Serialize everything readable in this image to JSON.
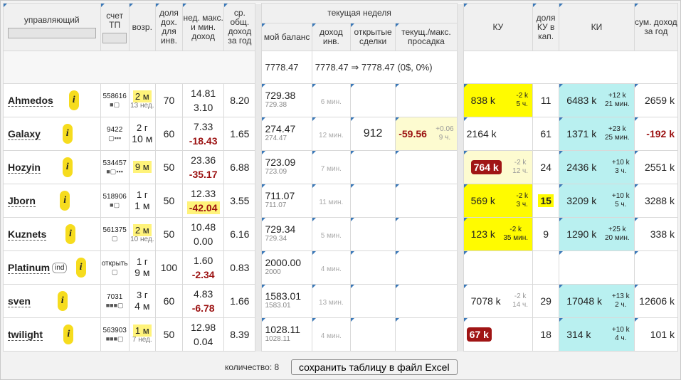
{
  "headers": {
    "manager": "управляющий",
    "account": "счет ТП",
    "age": "возр.",
    "share": "доля дох. для инв.",
    "weekly": "нед. макс. и мин. доход",
    "avg_income": "ср. общ. доход за год",
    "current_week": "текущая неделя",
    "my_balance": "мой баланс",
    "inv_income": "доход инв.",
    "open_deals": "открытые сделки",
    "drawdown": "текущ./макс. просадка",
    "ku": "КУ",
    "ku_share": "доля КУ в кап.",
    "ki": "КИ",
    "total_income": "сум. доход за год"
  },
  "summary": {
    "balance": "7778.47",
    "income_text": "7778.47 ⇒ 7778.47 (0$, 0%)"
  },
  "rows": [
    {
      "name": "Ahmedos",
      "tag": "",
      "account": "558616",
      "dots": "■▢",
      "age1": "2 м",
      "age2": "13 нед.",
      "age_hl": true,
      "share": "70",
      "wmax": "14.81",
      "wmin": "3.10",
      "wmin_neg": false,
      "wmax_hl": false,
      "wmin_hl": false,
      "avg": "8.20",
      "bal": "729.38",
      "bal_sub": "729.38",
      "inc": "6 мин.",
      "deals": "",
      "dd": "",
      "dd_sub1": "",
      "dd_sub2": "",
      "ku": "838 k",
      "ku_d1": "-2 k",
      "ku_d2": "5 ч.",
      "ku_style": "yb",
      "ku_red": false,
      "kus": "11",
      "kus_hl": false,
      "ki": "6483 k",
      "ki_d1": "+12 k",
      "ki_d2": "21 мин.",
      "ki_cyan": true,
      "total": "2659 k",
      "total_neg": false
    },
    {
      "name": "Galaxy",
      "tag": "",
      "account": "9422",
      "dots": "▢▪▪▪",
      "age1": "2 г",
      "age2": "10 м",
      "age_hl": false,
      "share": "60",
      "wmax": "7.33",
      "wmin": "-18.43",
      "wmin_neg": true,
      "wmax_hl": false,
      "wmin_hl": false,
      "avg": "1.65",
      "bal": "274.47",
      "bal_sub": "274.47",
      "inc": "12 мин.",
      "deals": "912",
      "dd": "-59.56",
      "dd_sub1": "+0.06",
      "dd_sub2": "9 ч.",
      "ku": "2164 k",
      "ku_d1": "",
      "ku_d2": "",
      "ku_style": "",
      "ku_red": false,
      "kus": "61",
      "kus_hl": false,
      "ki": "1371 k",
      "ki_d1": "+23 k",
      "ki_d2": "25 мин.",
      "ki_cyan": true,
      "total": "-192 k",
      "total_neg": true
    },
    {
      "name": "Hozyin",
      "tag": "",
      "account": "534457",
      "dots": "■▢▪▪▪",
      "age1": "9 м",
      "age2": "",
      "age_hl": true,
      "share": "50",
      "wmax": "23.36",
      "wmin": "-35.17",
      "wmin_neg": true,
      "wmax_hl": false,
      "wmin_hl": false,
      "avg": "6.88",
      "bal": "723.09",
      "bal_sub": "723.09",
      "inc": "7 мин.",
      "deals": "",
      "dd": "",
      "dd_sub1": "",
      "dd_sub2": "",
      "ku": "764 k",
      "ku_d1": "-2 k",
      "ku_d2": "12 ч.",
      "ku_style": "ylight",
      "ku_red": true,
      "kus": "24",
      "kus_hl": false,
      "ki": "2436 k",
      "ki_d1": "+10 k",
      "ki_d2": "3 ч.",
      "ki_cyan": true,
      "total": "2551 k",
      "total_neg": false
    },
    {
      "name": "Jborn",
      "tag": "",
      "account": "518906",
      "dots": "■▢",
      "age1": "1 г",
      "age2": "1 м",
      "age_hl": false,
      "share": "50",
      "wmax": "12.33",
      "wmin": "-42.04",
      "wmin_neg": true,
      "wmax_hl": false,
      "wmin_hl": true,
      "avg": "3.55",
      "bal": "711.07",
      "bal_sub": "711.07",
      "inc": "11 мин.",
      "deals": "",
      "dd": "",
      "dd_sub1": "",
      "dd_sub2": "",
      "ku": "569 k",
      "ku_d1": "-2 k",
      "ku_d2": "3 ч.",
      "ku_style": "yb",
      "ku_red": false,
      "kus": "15",
      "kus_hl": true,
      "ki": "3209 k",
      "ki_d1": "+10 k",
      "ki_d2": "5 ч.",
      "ki_cyan": true,
      "total": "3288 k",
      "total_neg": false
    },
    {
      "name": "Kuznets",
      "tag": "",
      "account": "561375",
      "dots": "▢",
      "age1": "2 м",
      "age2": "10 нед.",
      "age_hl": true,
      "share": "50",
      "wmax": "10.48",
      "wmin": "0.00",
      "wmin_neg": false,
      "wmax_hl": false,
      "wmin_hl": false,
      "avg": "6.16",
      "bal": "729.34",
      "bal_sub": "729.34",
      "inc": "5 мин.",
      "deals": "",
      "dd": "",
      "dd_sub1": "",
      "dd_sub2": "",
      "ku": "123 k",
      "ku_d1": "-2 k",
      "ku_d2": "35 мин.",
      "ku_style": "yb",
      "ku_red": false,
      "kus": "9",
      "kus_hl": false,
      "ki": "1290 k",
      "ki_d1": "+25 k",
      "ki_d2": "20 мин.",
      "ki_cyan": true,
      "total": "338 k",
      "total_neg": false
    },
    {
      "name": "Platinum",
      "tag": "ind",
      "account": "открыть",
      "dots": "▢",
      "age1": "1 г",
      "age2": "9 м",
      "age_hl": false,
      "share": "100",
      "wmax": "1.60",
      "wmin": "-2.34",
      "wmin_neg": true,
      "wmax_hl": false,
      "wmin_hl": false,
      "avg": "0.83",
      "bal": "2000.00",
      "bal_sub": "2000",
      "inc": "4 мин.",
      "deals": "",
      "dd": "",
      "dd_sub1": "",
      "dd_sub2": "",
      "ku": "",
      "ku_d1": "",
      "ku_d2": "",
      "ku_style": "",
      "ku_red": false,
      "kus": "",
      "kus_hl": false,
      "ki": "",
      "ki_d1": "",
      "ki_d2": "",
      "ki_cyan": false,
      "total": "",
      "total_neg": false
    },
    {
      "name": "sven",
      "tag": "",
      "account": "7031",
      "dots": "■■■▢",
      "age1": "3 г",
      "age2": "4 м",
      "age_hl": false,
      "share": "60",
      "wmax": "4.83",
      "wmin": "-6.78",
      "wmin_neg": true,
      "wmax_hl": false,
      "wmin_hl": false,
      "avg": "1.66",
      "bal": "1583.01",
      "bal_sub": "1583.01",
      "inc": "13 мин.",
      "deals": "",
      "dd": "",
      "dd_sub1": "",
      "dd_sub2": "",
      "ku": "7078 k",
      "ku_d1": "-2 k",
      "ku_d2": "14 ч.",
      "ku_style": "",
      "ku_red": false,
      "kus": "29",
      "kus_hl": false,
      "ki": "17048 k",
      "ki_d1": "+13 k",
      "ki_d2": "2 ч.",
      "ki_cyan": true,
      "total": "12606 k",
      "total_neg": false
    },
    {
      "name": "twilight",
      "tag": "",
      "account": "563903",
      "dots": "■■■▢",
      "age1": "1 м",
      "age2": "7 нед.",
      "age_hl": true,
      "share": "50",
      "wmax": "12.98",
      "wmin": "0.04",
      "wmin_neg": false,
      "wmax_hl": false,
      "wmin_hl": false,
      "avg": "8.39",
      "bal": "1028.11",
      "bal_sub": "1028.11",
      "inc": "4 мин.",
      "deals": "",
      "dd": "",
      "dd_sub1": "",
      "dd_sub2": "",
      "ku": "67 k",
      "ku_d1": "",
      "ku_d2": "",
      "ku_style": "",
      "ku_red": true,
      "kus": "18",
      "kus_hl": false,
      "ki": "314 k",
      "ki_d1": "+10 k",
      "ki_d2": "4 ч.",
      "ki_cyan": true,
      "total": "101 k",
      "total_neg": false
    }
  ],
  "footer": {
    "count_label": "количество: 8",
    "export_button": "сохранить таблицу в файл Excel"
  },
  "colors": {
    "yellow": "#fffb00",
    "cyan": "#b9f0f0",
    "red": "#a01515",
    "info": "#f6dc1e"
  }
}
